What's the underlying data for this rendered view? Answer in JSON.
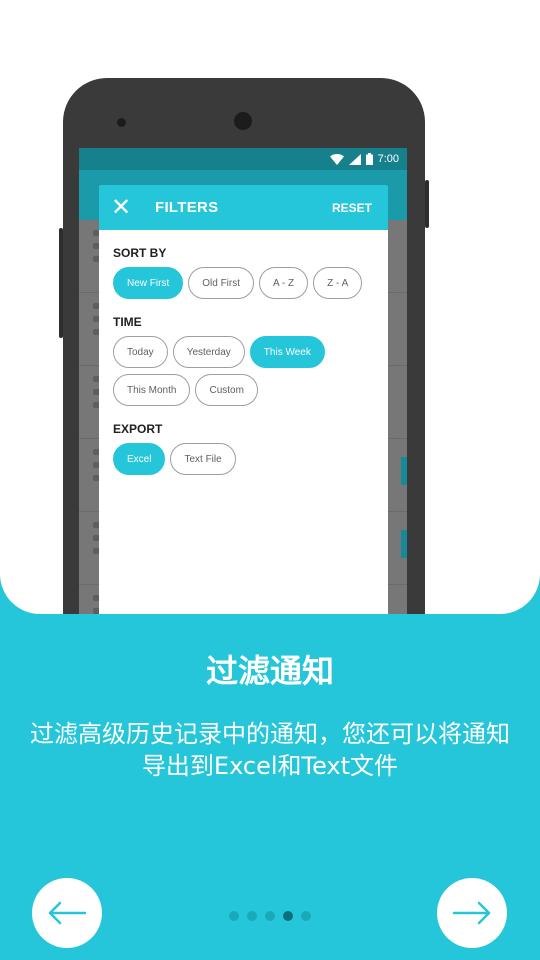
{
  "status_bar": {
    "time": "7:00"
  },
  "dialog": {
    "title": "FILTERS",
    "reset_label": "RESET",
    "sort_by": {
      "title": "SORT BY",
      "options": [
        "New First",
        "Old First",
        "A - Z",
        "Z - A"
      ],
      "selected": "New First"
    },
    "time": {
      "title": "TIME",
      "options": [
        "Today",
        "Yesterday",
        "This Week",
        "This Month",
        "Custom"
      ],
      "selected": "This Week"
    },
    "export": {
      "title": "EXPORT",
      "options": [
        "Excel",
        "Text File"
      ],
      "selected": "Excel"
    }
  },
  "onboarding": {
    "headline": "过滤通知",
    "description": "过滤高级历史记录中的通知，您还可以将通知导出到Excel和Text文件",
    "page_index": 4,
    "page_count": 5
  },
  "icons": {
    "prev": "arrow-left-icon",
    "next": "arrow-right-icon",
    "close": "close-icon"
  },
  "colors": {
    "accent": "#26C6DA",
    "phone_body": "#3a3a3a"
  }
}
